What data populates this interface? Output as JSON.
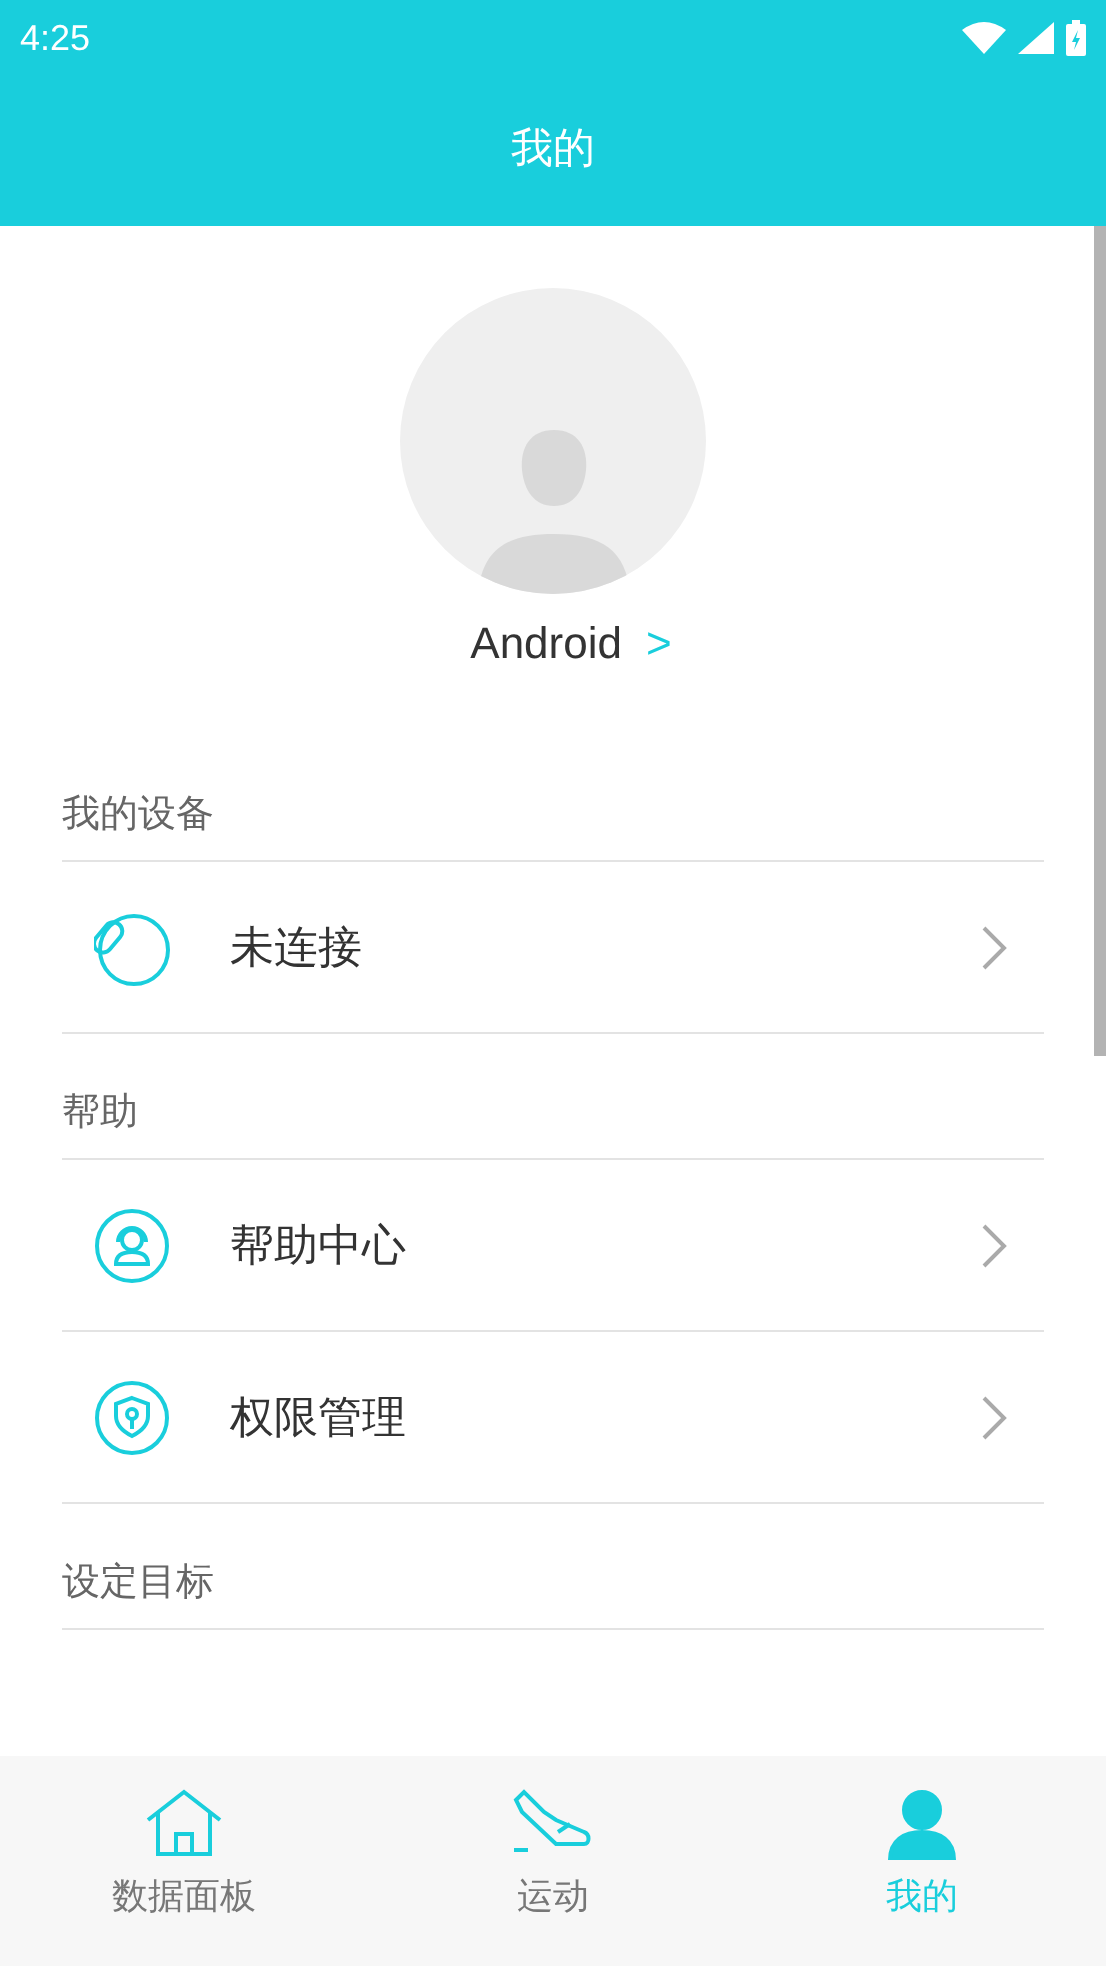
{
  "status_bar": {
    "time": "4:25"
  },
  "header": {
    "title": "我的"
  },
  "profile": {
    "name": "Android",
    "chevron": ">"
  },
  "sections": [
    {
      "title": "我的设备",
      "items": [
        {
          "kind": "band",
          "label": "未连接"
        }
      ]
    },
    {
      "title": "帮助",
      "items": [
        {
          "kind": "support",
          "label": "帮助中心"
        },
        {
          "kind": "shield",
          "label": "权限管理"
        }
      ]
    },
    {
      "title": "设定目标"
    }
  ],
  "tabs": [
    {
      "kind": "home",
      "label": "数据面板",
      "selected": false
    },
    {
      "kind": "shoe",
      "label": "运动",
      "selected": false
    },
    {
      "kind": "person",
      "label": "我的",
      "selected": true
    }
  ]
}
